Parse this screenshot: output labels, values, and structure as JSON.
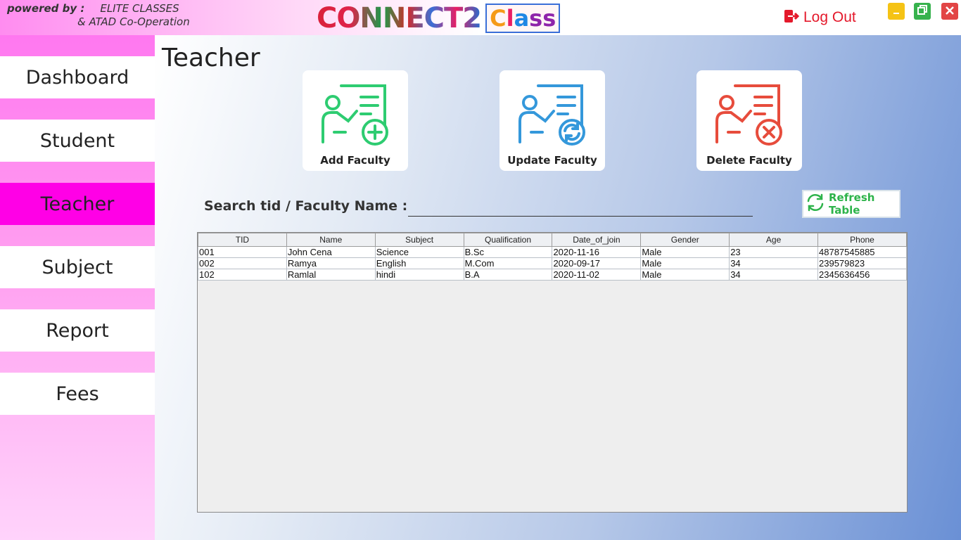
{
  "header": {
    "powered_by": "powered by :",
    "org1": "ELITE CLASSES",
    "org2": "& ATAD Co-Operation",
    "logo_main": "CONNECT2",
    "logo_class": [
      "C",
      "l",
      "a",
      "ss"
    ],
    "logout_label": "Log Out",
    "logout_icon": "logout-icon",
    "window_controls": [
      "minimize-icon",
      "restore-icon",
      "close-icon"
    ]
  },
  "sidebar": {
    "items": [
      {
        "label": "Dashboard",
        "active": false
      },
      {
        "label": "Student",
        "active": false
      },
      {
        "label": "Teacher",
        "active": true
      },
      {
        "label": "Subject",
        "active": false
      },
      {
        "label": "Report",
        "active": false
      },
      {
        "label": "Fees",
        "active": false
      }
    ]
  },
  "main": {
    "title": "Teacher",
    "actions": [
      {
        "label": "Add Faculty",
        "icon": "add-faculty-icon",
        "color": "#2ecc71"
      },
      {
        "label": "Update Faculty",
        "icon": "update-faculty-icon",
        "color": "#3498db"
      },
      {
        "label": "Delete Faculty",
        "icon": "delete-faculty-icon",
        "color": "#e74c3c"
      }
    ],
    "search_label": "Search tid / Faculty Name :",
    "search_value": "",
    "refresh_label": "Refresh Table",
    "refresh_icon": "refresh-icon"
  },
  "table": {
    "columns": [
      "TID",
      "Name",
      "Subject",
      "Qualification",
      "Date_of_join",
      "Gender",
      "Age",
      "Phone"
    ],
    "rows": [
      [
        "001",
        "John Cena",
        "Science",
        "B.Sc",
        "2020-11-16",
        "Male",
        "23",
        "48787545885"
      ],
      [
        "002",
        "Ramya",
        "English",
        "M.Com",
        "2020-09-17",
        "Male",
        "34",
        "239579823"
      ],
      [
        "102",
        "Ramlal",
        "hindi",
        "B.A",
        "2020-11-02",
        "Male",
        "34",
        "2345636456"
      ]
    ]
  },
  "colors": {
    "sidebar_active": "#ff00e6",
    "logout": "#e4192b",
    "refresh": "#2db34a"
  }
}
